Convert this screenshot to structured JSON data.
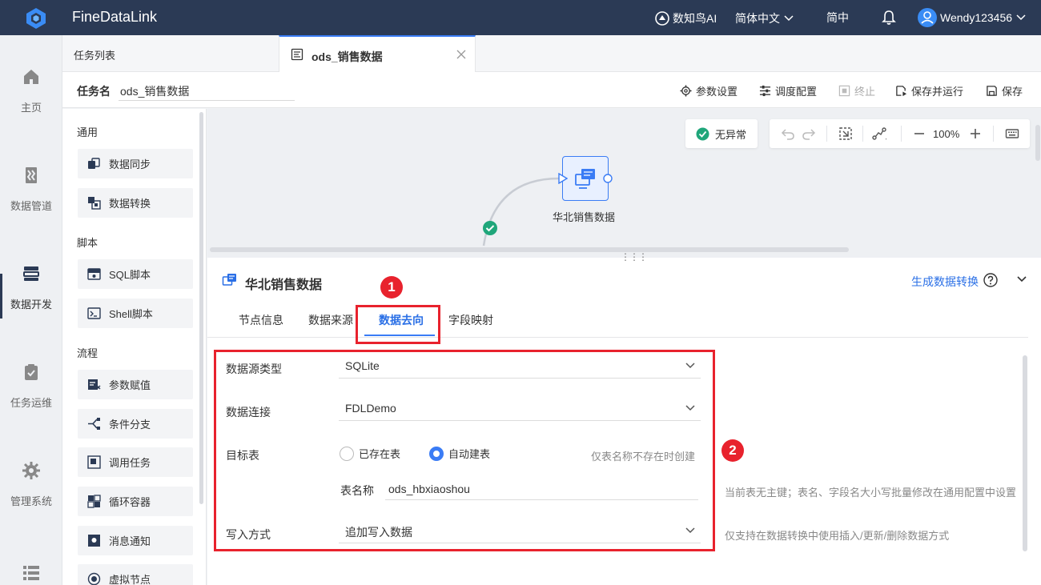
{
  "topbar": {
    "app_title": "FineDataLink",
    "ai_label": "数知鸟AI",
    "language": "简体中文",
    "simplified": "简中",
    "user": "Wendy123456"
  },
  "nav": {
    "items": [
      {
        "label": "主页",
        "icon": "home-icon"
      },
      {
        "label": "数据管道",
        "icon": "pipeline-icon"
      },
      {
        "label": "数据开发",
        "icon": "dev-icon"
      },
      {
        "label": "任务运维",
        "icon": "ops-icon"
      },
      {
        "label": "管理系统",
        "icon": "gear-icon"
      }
    ]
  },
  "tabs": {
    "list_label": "任务列表",
    "active_label": "ods_销售数据"
  },
  "toolbar": {
    "task_name_label": "任务名",
    "task_name_value": "ods_销售数据",
    "params": "参数设置",
    "schedule": "调度配置",
    "stop": "终止",
    "save_run": "保存并运行",
    "save": "保存"
  },
  "components": {
    "group_general": "通用",
    "data_sync": "数据同步",
    "data_transform": "数据转换",
    "group_script": "脚本",
    "sql_script": "SQL脚本",
    "shell_script": "Shell脚本",
    "group_flow": "流程",
    "param_assign": "参数赋值",
    "condition_branch": "条件分支",
    "call_task": "调用任务",
    "loop_container": "循环容器",
    "message_notify": "消息通知",
    "virtual_node": "虚拟节点"
  },
  "canvas": {
    "status": "无异常",
    "zoom": "100%",
    "node_label": "华北销售数据"
  },
  "panel": {
    "title": "华北销售数据",
    "gen_link": "生成数据转换",
    "tabs": [
      "节点信息",
      "数据来源",
      "数据去向",
      "字段映射"
    ],
    "active_tab_index": 2,
    "badge1": "1",
    "badge2": "2",
    "fields": {
      "source_type_label": "数据源类型",
      "source_type_value": "SQLite",
      "connection_label": "数据连接",
      "connection_value": "FDLDemo",
      "target_label": "目标表",
      "radio_existing": "已存在表",
      "radio_auto": "自动建表",
      "auto_hint": "仅表名称不存在时创建",
      "table_name_label": "表名称",
      "table_name_value": "ods_hbxiaoshou",
      "table_hint": "当前表无主键；表名、字段名大小写批量修改在通用配置中设置",
      "write_mode_label": "写入方式",
      "write_mode_value": "追加写入数据",
      "write_hint": "仅支持在数据转换中使用插入/更新/删除数据方式"
    }
  },
  "colors": {
    "topbar": "#2b3a55",
    "accent": "#3a7cf5",
    "highlight": "#e8222d",
    "success": "#1fa67a"
  }
}
